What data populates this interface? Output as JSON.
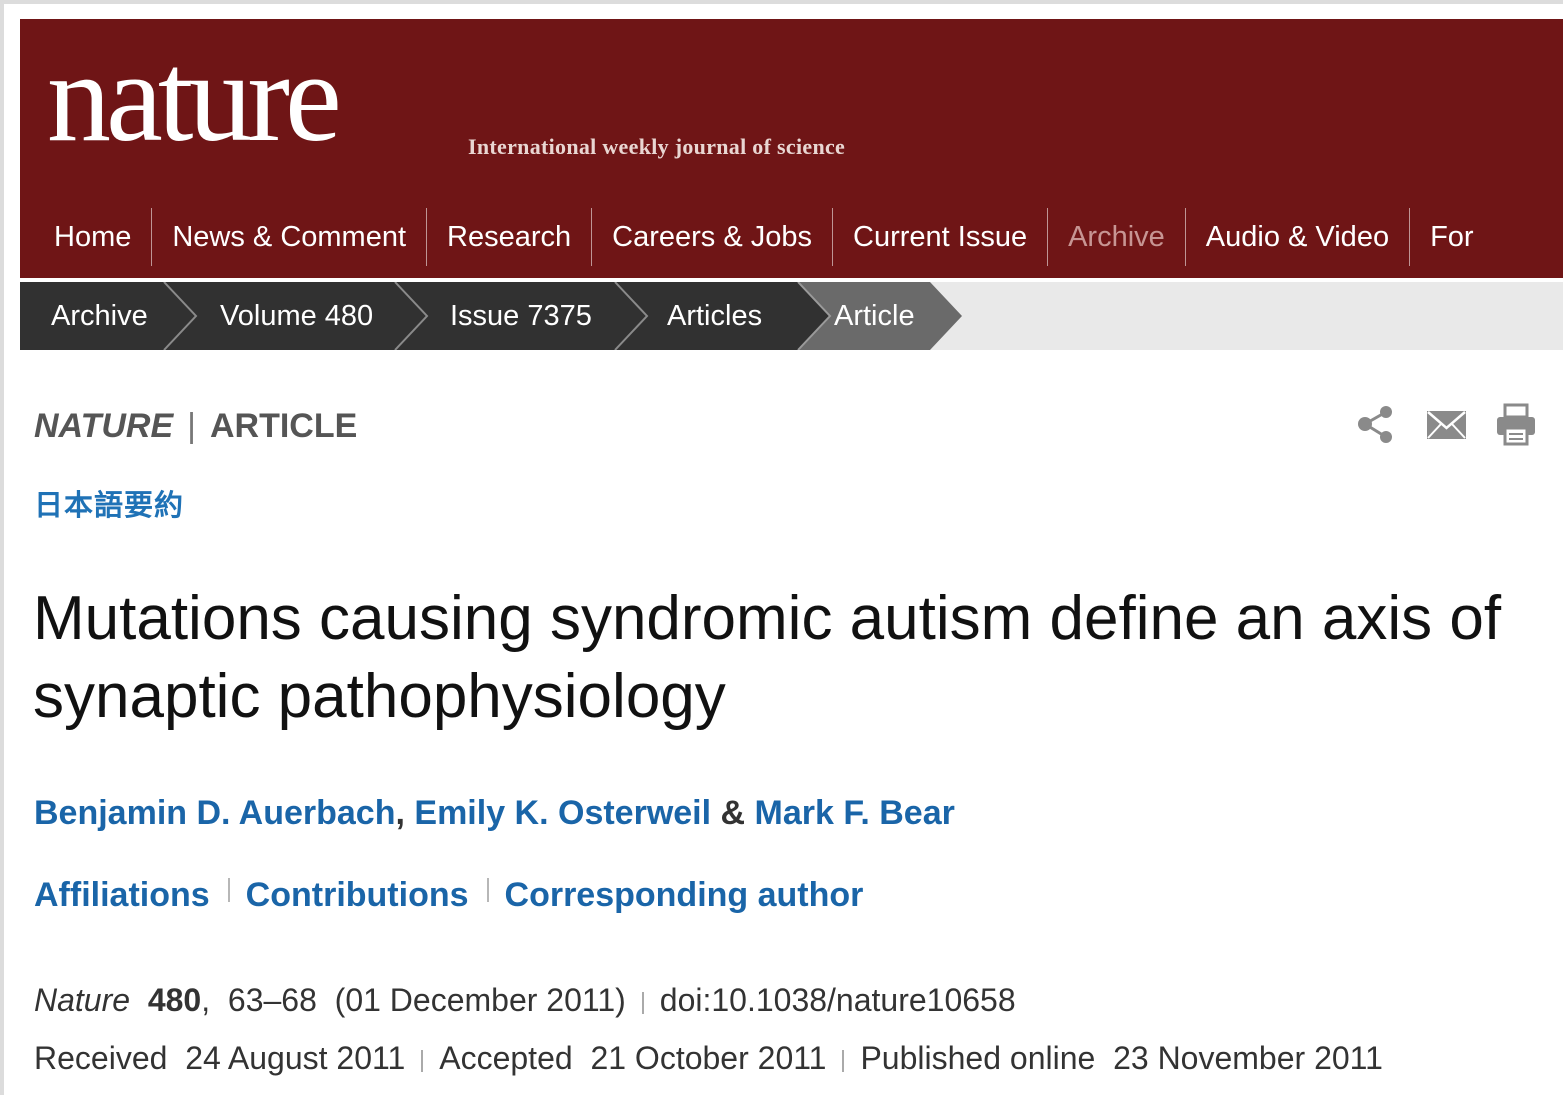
{
  "brand": {
    "logo": "nature",
    "tagline": "International weekly journal of science",
    "color": "#6f1516"
  },
  "nav": {
    "items": [
      {
        "label": "Home"
      },
      {
        "label": "News & Comment"
      },
      {
        "label": "Research"
      },
      {
        "label": "Careers & Jobs"
      },
      {
        "label": "Current Issue"
      },
      {
        "label": "Archive",
        "active": true
      },
      {
        "label": "Audio & Video"
      },
      {
        "label": "For"
      }
    ]
  },
  "breadcrumb": {
    "items": [
      "Archive",
      "Volume 480",
      "Issue 7375",
      "Articles",
      "Article"
    ]
  },
  "article": {
    "journal": "NATURE",
    "type": "ARTICLE",
    "japanese_summary": "日本語要約",
    "title": "Mutations causing syndromic autism define an axis of synaptic pathophysiology",
    "authors": [
      "Benjamin D. Auerbach",
      "Emily K. Osterweil",
      "Mark F. Bear"
    ],
    "author_links": [
      "Affiliations",
      "Contributions",
      "Corresponding author"
    ],
    "citation": {
      "journal": "Nature",
      "volume": "480",
      "pages": "63–68",
      "date": "(01 December 2011)",
      "doi": "doi:10.1038/nature10658"
    },
    "dates": [
      {
        "label": "Received",
        "value": "24 August 2011"
      },
      {
        "label": "Accepted",
        "value": "21 October 2011"
      },
      {
        "label": "Published online",
        "value": "23 November 2011"
      }
    ]
  },
  "tools": [
    "share-icon",
    "email-icon",
    "print-icon"
  ]
}
